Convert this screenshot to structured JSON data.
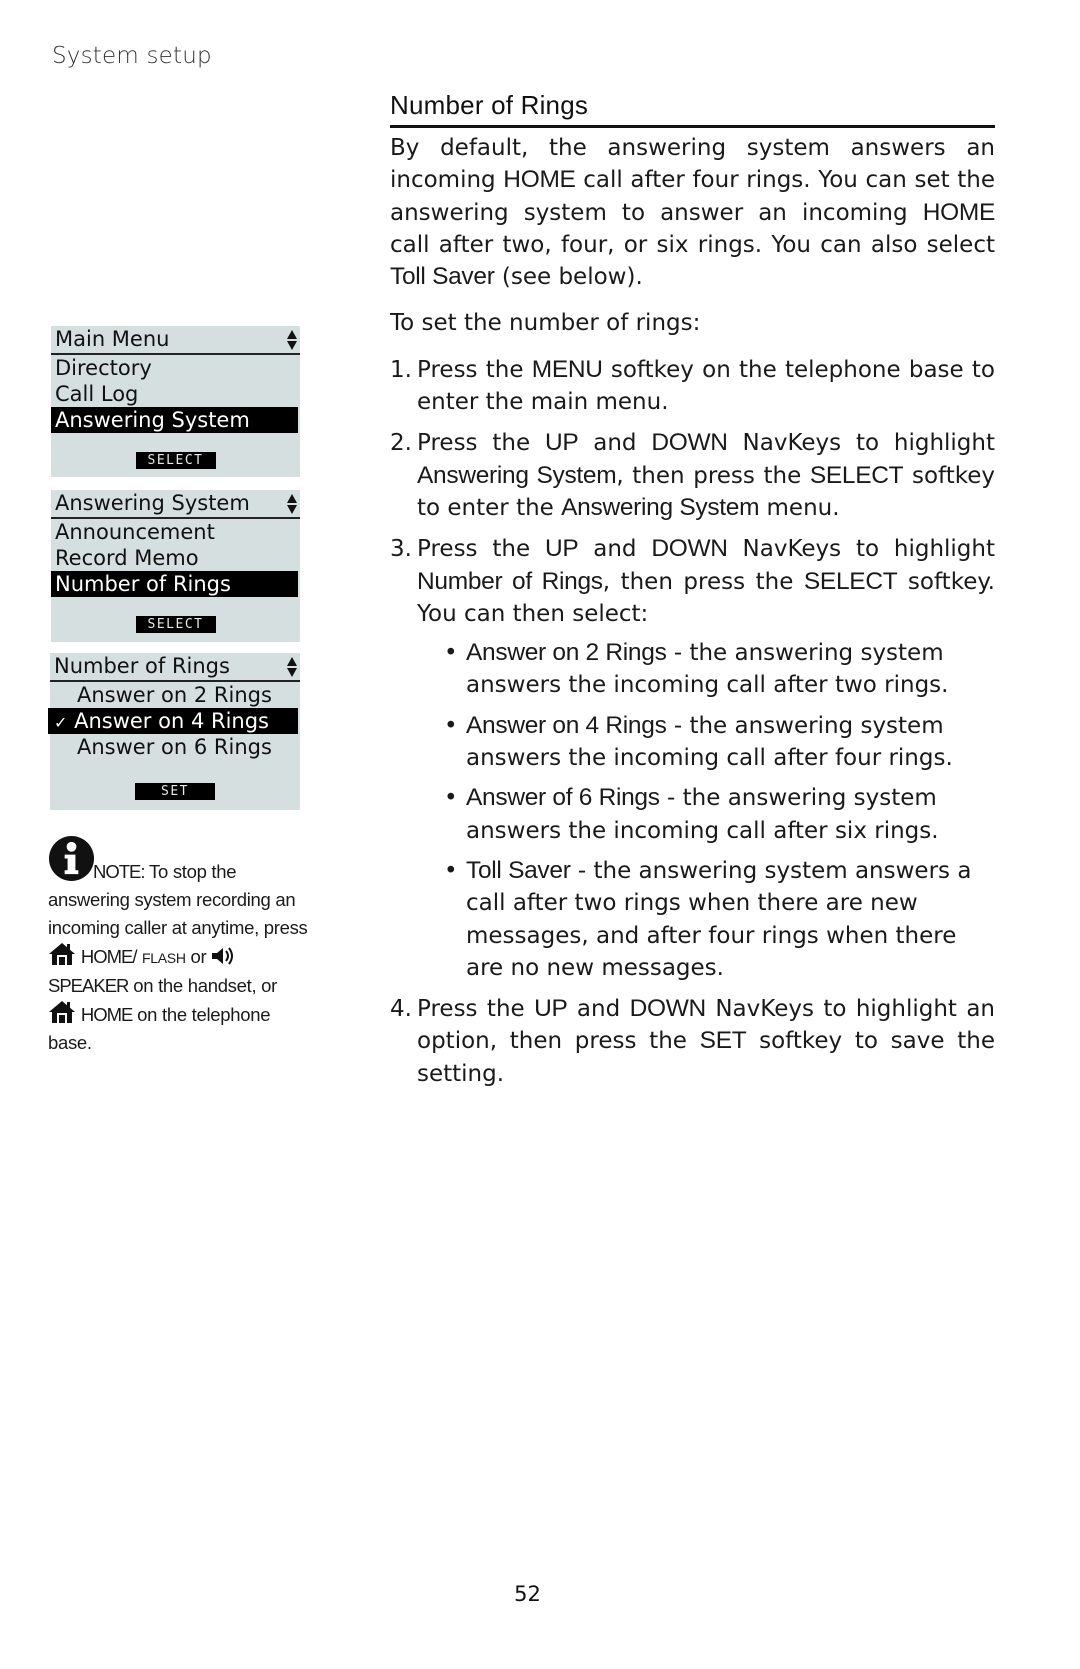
{
  "header": {
    "section": "System setup"
  },
  "title": "Number of Rings",
  "intro": {
    "parts": [
      "By default, the answering system answers an incoming ",
      "HOME",
      " call after four rings. You can set the answering system to answer an incoming ",
      "HOME",
      " call after two, four, or six rings. You can also select ",
      "Toll Saver",
      " (see below)."
    ]
  },
  "lead": "To set the number of rings:",
  "steps": [
    {
      "num": "1.",
      "parts": [
        "Press the ",
        "MENU",
        " softkey on the telephone base to enter the main menu."
      ]
    },
    {
      "num": "2.",
      "parts": [
        "Press the ",
        "UP",
        " and ",
        "DOWN",
        " NavKeys to highlight ",
        "Answering System",
        ", then press the ",
        "SELECT",
        " softkey to enter the ",
        "Answering System",
        " menu."
      ]
    },
    {
      "num": "3.",
      "parts": [
        "Press the ",
        "UP",
        " and ",
        "DOWN",
        " NavKeys to highlight ",
        "Number of Rings",
        ", then press the ",
        "SELECT",
        " softkey. You can then select:"
      ],
      "bullets": [
        {
          "term": "Answer on 2 Rings",
          "desc": " - the answering system answers the incoming call after two rings."
        },
        {
          "term": "Answer on 4 Rings",
          "desc": " - the answering system answers the incoming call after four rings."
        },
        {
          "term": "Answer of 6 Rings",
          "desc": " - the answering system answers the incoming call after six rings."
        },
        {
          "term": "Toll Saver",
          "desc": " - the answering system answers a call after two rings when there are new messages, and after four rings when there are no new messages."
        }
      ]
    },
    {
      "num": "4.",
      "parts": [
        "Press the ",
        "UP",
        " and ",
        "DOWN",
        " NavKeys to highlight an option, then press the ",
        "SET",
        " softkey to save the setting."
      ]
    }
  ],
  "screens": [
    {
      "header": "Main Menu",
      "items": [
        "Directory",
        "Call Log",
        "Answering System"
      ],
      "selected_index": 2,
      "softkey": "SELECT"
    },
    {
      "header": "Answering System",
      "items": [
        "Announcement",
        "Record Memo",
        "Number of Rings"
      ],
      "selected_index": 2,
      "softkey": "SELECT"
    },
    {
      "header": "Number of Rings",
      "items": [
        "Answer on 2 Rings",
        "Answer on 4 Rings",
        "Answer on 6 Rings"
      ],
      "selected_index": 1,
      "checkmark": "✓",
      "softkey": "SET"
    }
  ],
  "note": {
    "label": "NOTE:",
    "text1": " To stop the answering system recording an incoming caller at anytime, press ",
    "home": "HOME",
    "slash": "/ ",
    "flash": "FLASH",
    "or1": " or ",
    "speaker": "SPEAKER",
    "text2": " on the handset, or ",
    "home2": "HOME",
    "text3": " on the telephone base."
  },
  "page_number": "52"
}
